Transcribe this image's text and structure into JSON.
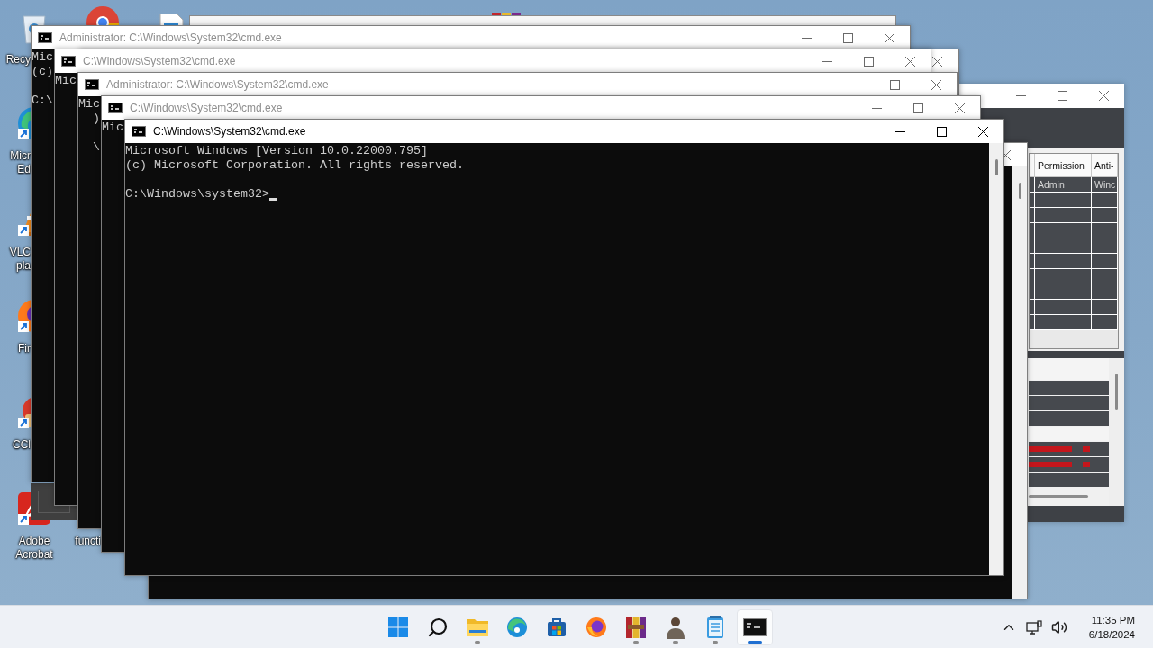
{
  "desktop_icons": [
    {
      "kind": "recycle-bin",
      "label_lines": [
        "Recy"
      ]
    },
    {
      "kind": "chrome"
    },
    {
      "kind": "file"
    },
    {
      "kind": "winrar"
    },
    {
      "kind": "edge",
      "label_lines": [
        "Micr",
        "Ed"
      ]
    },
    {
      "kind": "vlc",
      "label_lines": [
        "VLC",
        "pla"
      ]
    },
    {
      "kind": "firefox",
      "label_lines": [
        "Fir"
      ]
    },
    {
      "kind": "ccleaner",
      "label_lines": [
        "CCl"
      ]
    },
    {
      "kind": "acrobat",
      "label_lines": [
        "Adobe",
        "Acrobat"
      ]
    },
    {
      "kind": "hidden",
      "label_lines": [
        "functi"
      ]
    }
  ],
  "windows": [
    {
      "kind": "blank"
    },
    {
      "kind": "app",
      "table": {
        "columns": [
          "Permission",
          "Anti-"
        ],
        "rows": [
          [
            "Admin",
            "Winc"
          ]
        ]
      }
    },
    {
      "kind": "console",
      "title": "Administrator: C:\\Windows\\System32\\cmd.exe",
      "active": false,
      "output": [
        "Mic",
        "(c)"
      ],
      "prompt": "C:\\"
    },
    {
      "kind": "console"
    },
    {
      "kind": "console",
      "title": "C:\\Windows\\System32\\cmd.exe",
      "active": false,
      "output": [
        "Mic"
      ]
    },
    {
      "kind": "console",
      "title": "Administrator: C:\\Windows\\System32\\cmd.exe",
      "active": false,
      "output": [
        "Mic",
        "  )"
      ],
      "prompt": "  \\"
    },
    {
      "kind": "console",
      "title": "C:\\Windows\\System32\\cmd.exe",
      "active": false,
      "output": [
        "Mic"
      ]
    },
    {
      "kind": "console"
    },
    {
      "kind": "console",
      "title": "C:\\Windows\\System32\\cmd.exe",
      "active": true,
      "output": [
        "Microsoft Windows [Version 10.0.22000.795]",
        "(c) Microsoft Corporation. All rights reserved."
      ],
      "prompt": "C:\\Windows\\system32>",
      "cursor": true
    }
  ],
  "taskbar": {
    "apps": [
      {
        "kind": "start",
        "running": false,
        "selected": false
      },
      {
        "kind": "search",
        "running": false,
        "selected": false
      },
      {
        "kind": "explorer",
        "running": true,
        "selected": false
      },
      {
        "kind": "edge",
        "running": false,
        "selected": false
      },
      {
        "kind": "store",
        "running": false,
        "selected": false
      },
      {
        "kind": "firefox",
        "running": false,
        "selected": false
      },
      {
        "kind": "winrar",
        "running": true,
        "selected": false
      },
      {
        "kind": "person",
        "running": true,
        "selected": false
      },
      {
        "kind": "notepad",
        "running": true,
        "selected": false
      },
      {
        "kind": "terminal",
        "running": true,
        "selected": true
      }
    ],
    "clock": {
      "time": "11:35 PM",
      "date": "6/18/2024"
    }
  }
}
